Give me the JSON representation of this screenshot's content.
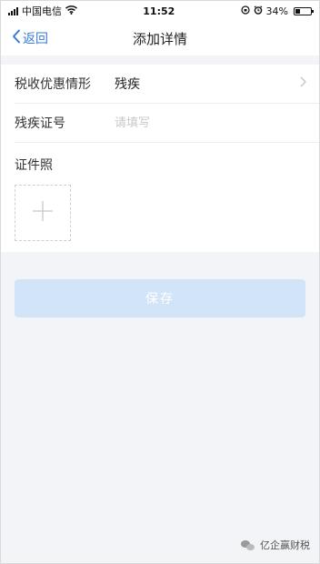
{
  "status_bar": {
    "carrier": "中国电信",
    "time": "11:52",
    "battery": "34%",
    "battery_level": 0.34
  },
  "nav": {
    "back_label": "返回",
    "title": "添加详情"
  },
  "form": {
    "tax_type_label": "税收优惠情形",
    "tax_type_value": "残疾",
    "cert_no_label": "残疾证号",
    "cert_no_placeholder": "请填写",
    "photo_label": "证件照"
  },
  "actions": {
    "save_label": "保存"
  },
  "watermark": {
    "text": "亿企赢财税"
  },
  "colors": {
    "accent": "#3a7bd5",
    "save_disabled": "#d2e4f8",
    "page_bg": "#f2f4f7"
  },
  "icons": {
    "back": "chevron-left-icon",
    "row_arrow": "chevron-right-icon",
    "upload": "plus-icon",
    "wifi": "wifi-icon",
    "lock": "orientation-lock-icon",
    "alarm": "alarm-icon",
    "battery": "battery-icon",
    "watermark": "wechat-icon"
  }
}
